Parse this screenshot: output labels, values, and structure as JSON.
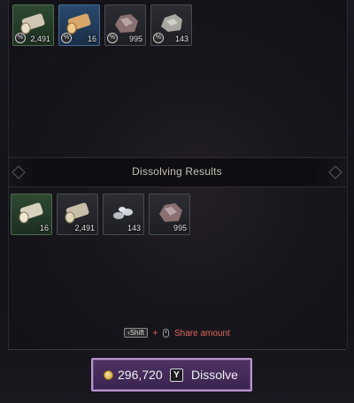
{
  "materials": [
    {
      "name": "timber",
      "qty": "2,491",
      "rarity": "normal",
      "marked": true
    },
    {
      "name": "tender-timber",
      "qty": "16",
      "rarity": "uncommon",
      "marked": true
    },
    {
      "name": "iron-ore",
      "qty": "995",
      "rarity": "normal",
      "marked": true
    },
    {
      "name": "heavy-iron-ore",
      "qty": "143",
      "rarity": "normal",
      "marked": true
    }
  ],
  "results_header": "Dissolving Results",
  "results": [
    {
      "name": "sturdy-timber",
      "qty": "16",
      "rarity": "green"
    },
    {
      "name": "timber",
      "qty": "2,491",
      "rarity": "normal"
    },
    {
      "name": "heavy-iron-ore",
      "qty": "143",
      "rarity": "normal"
    },
    {
      "name": "iron-ore",
      "qty": "995",
      "rarity": "normal"
    }
  ],
  "hint": {
    "key": "Shift",
    "plus": "+",
    "text": "Share amount"
  },
  "dissolve": {
    "price": "296,720",
    "key": "Y",
    "label": "Dissolve"
  },
  "colors": {
    "accent": "#b694cc",
    "button_bg": "#4e3262",
    "share_text": "#e0695a"
  }
}
